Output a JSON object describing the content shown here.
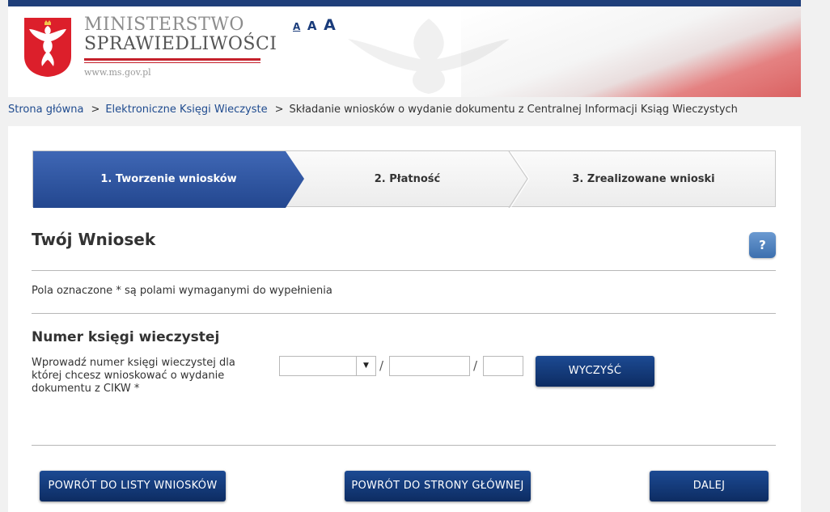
{
  "header": {
    "ministry_line1": "MINISTERSTWO",
    "ministry_line2": "SPRAWIEDLIWOŚCI",
    "url": "www.ms.gov.pl",
    "font_size_small": "A",
    "font_size_medium": "A",
    "font_size_large": "A",
    "colors": {
      "top_bar": "#1f3f7a",
      "flag_red": "#d85959",
      "emblem_red": "#c4202b"
    }
  },
  "breadcrumb": {
    "items": [
      "Strona główna",
      "Elektroniczne Księgi Wieczyste",
      "Składanie wniosków o wydanie dokumentu z Centralnej Informacji Ksiąg Wieczystych"
    ],
    "separator": ">"
  },
  "steps": {
    "items": [
      "1. Tworzenie wniosków",
      "2. Płatność",
      "3. Zrealizowane wnioski"
    ],
    "active_index": 0,
    "active_color": "#2f57a3"
  },
  "form": {
    "title": "Twój Wniosek",
    "help_label": "?",
    "required_note": "Pola oznaczone * są polami wymaganymi do wypełnienia",
    "kw_heading": "Numer księgi wieczystej",
    "kw_description": "Wprowadź numer księgi wieczystej dla której chcesz wnioskować o wydanie dokumentu z CIKW *",
    "court_code_value": "",
    "register_number_value": "",
    "check_digit_value": "",
    "separator": "/",
    "clear_button": "WYCZYŚĆ"
  },
  "footer_buttons": {
    "back_to_list": "POWRÓT DO LISTY WNIOSKÓW",
    "back_to_home": "POWRÓT DO STRONY GŁÓWNEJ",
    "next": "DALEJ"
  },
  "icons": [
    "polish-eagle-emblem",
    "help-icon",
    "dropdown-arrow-icon",
    "breadcrumb-chevron-icon"
  ]
}
